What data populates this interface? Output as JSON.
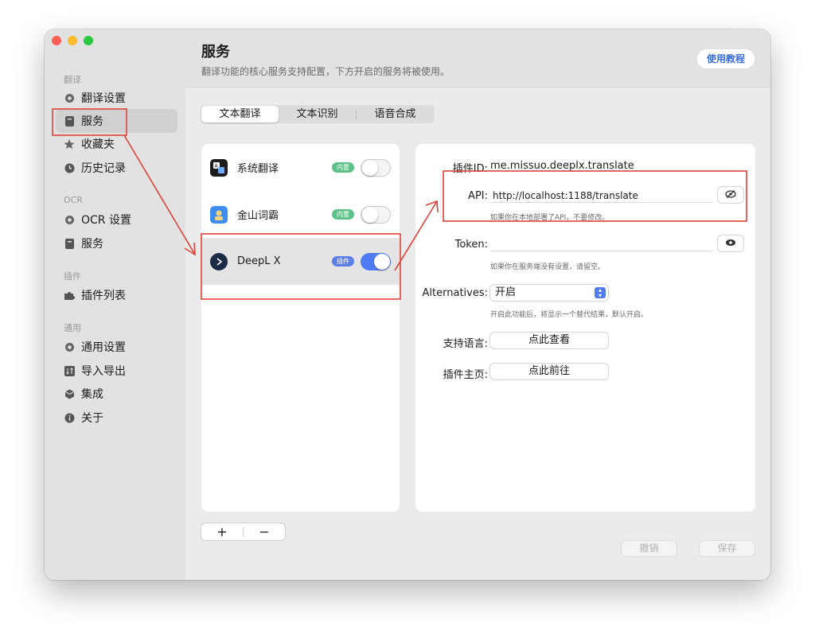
{
  "sidebar": {
    "sections": [
      {
        "header": "翻译",
        "items": [
          {
            "label": "翻译设置",
            "icon": "gear-icon"
          },
          {
            "label": "服务",
            "icon": "bookmark-icon",
            "active": true
          },
          {
            "label": "收藏夹",
            "icon": "star-icon"
          },
          {
            "label": "历史记录",
            "icon": "clock-icon"
          }
        ]
      },
      {
        "header": "OCR",
        "items": [
          {
            "label": "OCR 设置",
            "icon": "gear-icon"
          },
          {
            "label": "服务",
            "icon": "bookmark-icon"
          }
        ]
      },
      {
        "header": "插件",
        "items": [
          {
            "label": "插件列表",
            "icon": "puzzle-icon"
          }
        ]
      },
      {
        "header": "通用",
        "items": [
          {
            "label": "通用设置",
            "icon": "gear-icon"
          },
          {
            "label": "导入导出",
            "icon": "swap-icon"
          },
          {
            "label": "集成",
            "icon": "cube-icon"
          },
          {
            "label": "关于",
            "icon": "info-icon"
          }
        ]
      }
    ]
  },
  "header": {
    "title": "服务",
    "subtitle": "翻译功能的核心服务支持配置，下方开启的服务将被使用。",
    "tutorial_label": "使用教程"
  },
  "tabs": [
    {
      "label": "文本翻译",
      "active": true
    },
    {
      "label": "文本识别"
    },
    {
      "label": "语音合成"
    }
  ],
  "services": [
    {
      "name": "系统翻译",
      "badge": "内置",
      "enabled": false
    },
    {
      "name": "金山词霸",
      "badge": "内置",
      "enabled": false
    },
    {
      "name": "DeepL X",
      "badge": "插件",
      "enabled": true,
      "selected": true
    }
  ],
  "list_controls": {
    "add": "+",
    "remove": "−"
  },
  "detail": {
    "plugin_id_label": "插件ID:",
    "plugin_id_value": "me.missuo.deeplx.translate",
    "api_label": "API:",
    "api_value": "http://localhost:1188/translate",
    "api_hint": "如果你在本地部署了API，不要修改。",
    "token_label": "Token:",
    "token_value": "",
    "token_hint": "如果你在服务端没有设置，请留空。",
    "alternatives_label": "Alternatives:",
    "alternatives_value": "开启",
    "alternatives_hint": "开启此功能后，将显示一个替代结果，默认开启。",
    "languages_label": "支持语言:",
    "languages_button": "点此查看",
    "homepage_label": "插件主页:",
    "homepage_button": "点此前往"
  },
  "footer": {
    "cancel_label": "撤销",
    "save_label": "保存"
  },
  "colors": {
    "accent": "#4f7cf2",
    "annotation": "#e0423a",
    "badge_builtin": "#5cc28a",
    "badge_plugin": "#5b7ee8"
  }
}
